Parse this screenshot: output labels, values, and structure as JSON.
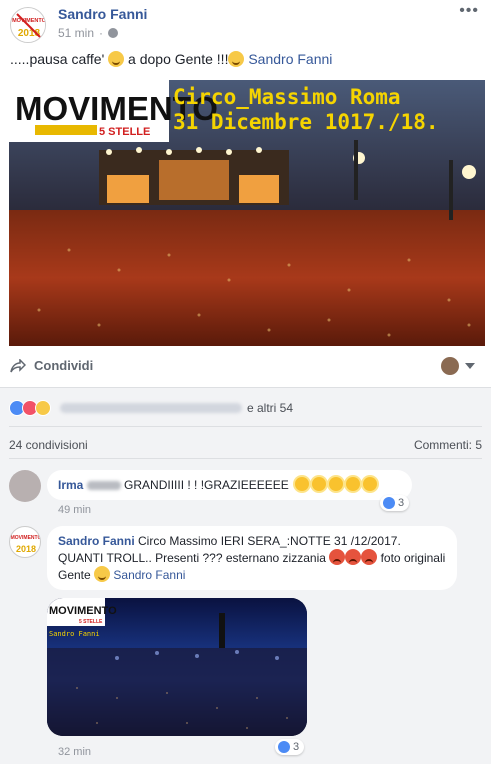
{
  "post": {
    "author": "Sandro Fanni",
    "time": "51 min",
    "text_before": ".....pausa caffe'",
    "text_middle": "a dopo Gente !!!",
    "tag": "Sandro Fanni",
    "more": "•••"
  },
  "image": {
    "logo_word": "MOVIMENTO",
    "logo_sub": "5 STELLE",
    "caption_line1": "Circo_Massimo Roma",
    "caption_line2": "31 Dicembre 1017./18."
  },
  "avatar_logo_text": "2018",
  "actions": {
    "share_label": "Condividi"
  },
  "feedback": {
    "others_label": "e altri 54",
    "shares_label": "24 condivisioni",
    "comments_label": "Commenti: 5"
  },
  "comments": [
    {
      "author": "Irma",
      "text": "GRANDIIIII ! ! !GRAZIEEEEEE",
      "time": "49 min"
    },
    {
      "author": "Sandro Fanni",
      "text": "Circo Massimo IERI SERA_:NOTTE 31 /12/2017. QUANTI TROLL.. Presenti ??? esternano zizzania",
      "text_end": "foto originali Gente",
      "tag": "Sandro Fanni",
      "likes": "3",
      "time": "32 min",
      "image_logo_word": "MOVIMENTO",
      "image_logo_sub": "5 STELLE",
      "image_sign": "Sandro Fanni"
    }
  ],
  "comment1_likes": "3",
  "colors": {
    "link": "#365899",
    "meta": "#90949c",
    "feedback_bg": "#f2f3f5",
    "like_blue": "#4c8bf5",
    "logo_red": "#d11f1f",
    "caption_yellow": "#f5d400"
  }
}
